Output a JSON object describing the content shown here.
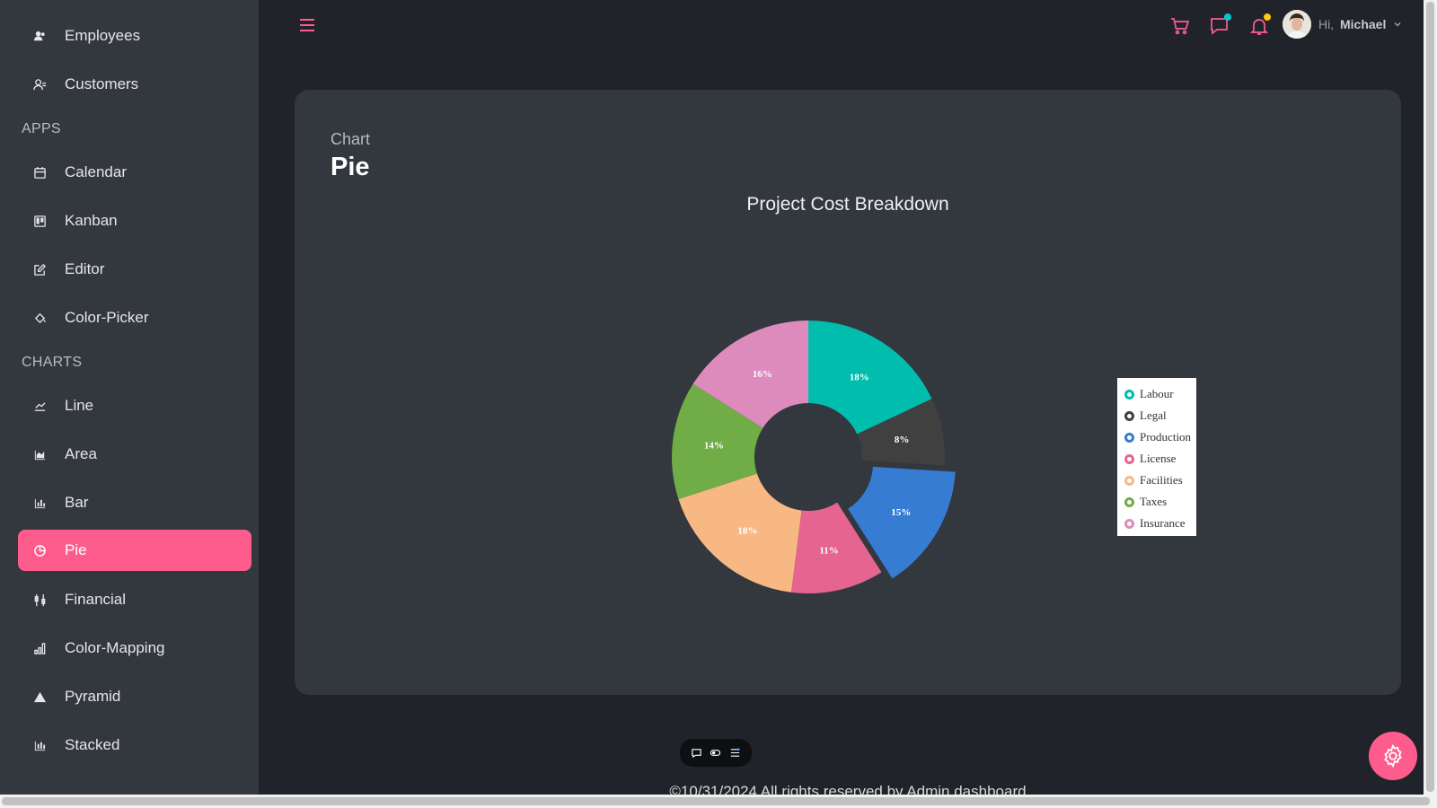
{
  "sidebar": {
    "items": [
      {
        "label": "Employees",
        "icon": "employees-icon"
      },
      {
        "label": "Customers",
        "icon": "customers-icon"
      },
      {
        "label": "Calendar",
        "icon": "calendar-icon"
      },
      {
        "label": "Kanban",
        "icon": "kanban-icon"
      },
      {
        "label": "Editor",
        "icon": "edit-icon"
      },
      {
        "label": "Color-Picker",
        "icon": "paint-bucket-icon"
      },
      {
        "label": "Line",
        "icon": "line-chart-icon"
      },
      {
        "label": "Area",
        "icon": "area-chart-icon"
      },
      {
        "label": "Bar",
        "icon": "bar-chart-icon"
      },
      {
        "label": "Pie",
        "icon": "pie-chart-icon",
        "active": true
      },
      {
        "label": "Financial",
        "icon": "financial-icon"
      },
      {
        "label": "Color-Mapping",
        "icon": "signal-bars-icon"
      },
      {
        "label": "Pyramid",
        "icon": "pyramid-icon"
      },
      {
        "label": "Stacked",
        "icon": "stacked-chart-icon"
      }
    ],
    "sections": {
      "apps": "APPS",
      "charts": "CHARTS"
    }
  },
  "header": {
    "greeting": "Hi,",
    "user_name": "Michael",
    "icons": [
      "cart-icon",
      "chat-icon",
      "bell-icon"
    ]
  },
  "page": {
    "category": "Chart",
    "title": "Pie"
  },
  "colors": {
    "accent": "#ff5c8e",
    "background": "#20232a",
    "card": "#33373e"
  },
  "chart_data": {
    "type": "pie",
    "title": "Project Cost Breakdown",
    "donut": true,
    "legend_position": "right",
    "series": [
      {
        "name": "Labour",
        "value": 18,
        "label": "18%",
        "color": "#00bdae"
      },
      {
        "name": "Legal",
        "value": 8,
        "label": "8%",
        "color": "#404041"
      },
      {
        "name": "Production",
        "value": 15,
        "label": "15%",
        "color": "#357cd2",
        "exploded": true
      },
      {
        "name": "License",
        "value": 11,
        "label": "11%",
        "color": "#e56590"
      },
      {
        "name": "Facilities",
        "value": 18,
        "label": "18%",
        "color": "#f8b883"
      },
      {
        "name": "Taxes",
        "value": 14,
        "label": "14%",
        "color": "#70ad47"
      },
      {
        "name": "Insurance",
        "value": 16,
        "label": "16%",
        "color": "#dd8abd"
      }
    ]
  },
  "footer": {
    "text": "©10/31/2024 All rights reserved by Admin dashboard"
  }
}
